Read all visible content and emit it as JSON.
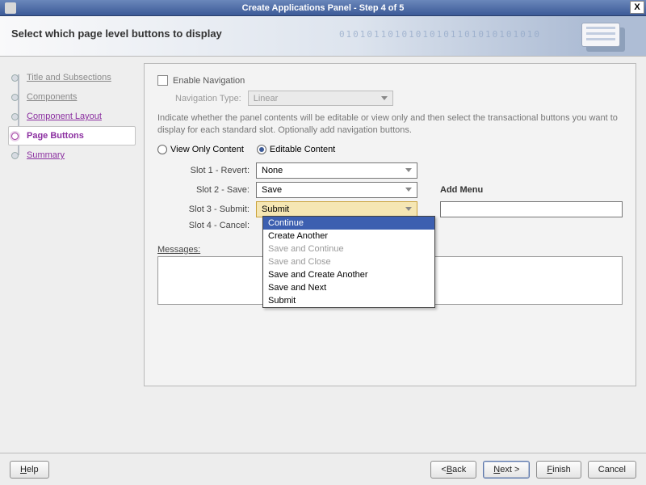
{
  "window": {
    "title": "Create Applications Panel - Step 4 of 5"
  },
  "header": {
    "heading": "Select which page level buttons to display",
    "binary_art": "01010110101010101101010101010"
  },
  "sidebar": {
    "steps": [
      {
        "label": "Title and Subsections"
      },
      {
        "label": "Components"
      },
      {
        "label": "Component Layout"
      },
      {
        "label": "Page Buttons"
      },
      {
        "label": "Summary"
      }
    ],
    "active_index": 3
  },
  "panel": {
    "enable_navigation_label": "Enable Navigation",
    "enable_navigation_checked": false,
    "navigation_type_label": "Navigation Type:",
    "navigation_type_value": "Linear",
    "help_text": "Indicate whether the panel contents will be editable or view only and then select the transactional buttons you want to display for each standard slot. Optionally add navigation buttons.",
    "content_mode": {
      "view_only_label": "View Only Content",
      "editable_label": "Editable Content",
      "selected": "editable"
    },
    "slots": [
      {
        "label": "Slot 1 - Revert:",
        "value": "None"
      },
      {
        "label": "Slot 2 - Save:",
        "value": "Save"
      },
      {
        "label": "Slot 3 - Submit:",
        "value": "Submit"
      },
      {
        "label": "Slot 4 - Cancel:",
        "value": ""
      }
    ],
    "add_menu_label": "Add Menu",
    "submit_dropdown_open": true,
    "submit_options": [
      {
        "label": "Continue",
        "selected": true
      },
      {
        "label": "Create Another"
      },
      {
        "label": "Save and Continue",
        "disabled": true
      },
      {
        "label": "Save and Close",
        "disabled": true
      },
      {
        "label": "Save and Create Another"
      },
      {
        "label": "Save and Next"
      },
      {
        "label": "Submit"
      }
    ],
    "messages_label": "Messages:"
  },
  "footer": {
    "help": "Help",
    "back": "< Back",
    "next": "Next >",
    "finish": "Finish",
    "cancel": "Cancel"
  }
}
